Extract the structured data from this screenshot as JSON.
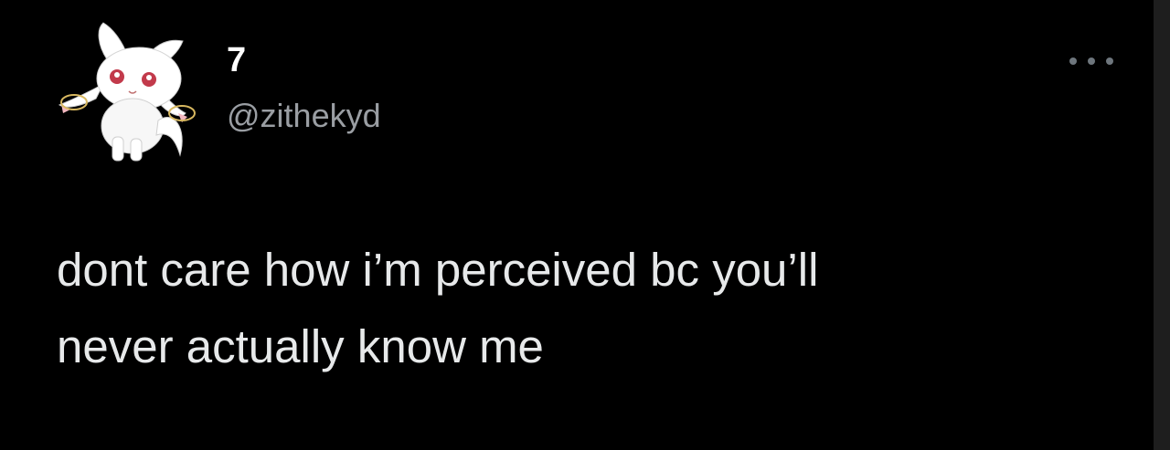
{
  "tweet": {
    "author": {
      "display_name": "7",
      "handle": "@zithekyd",
      "avatar_icon": "kyubey-cat-avatar-icon"
    },
    "more_icon": "more-options-icon",
    "text_lines": [
      "dont care how i’m perceived bc you’ll",
      "never actually know me"
    ]
  },
  "colors": {
    "background": "#000000",
    "text": "#e7e9ea",
    "handle": "#9a9ea3",
    "more_dots": "#6e767d"
  }
}
